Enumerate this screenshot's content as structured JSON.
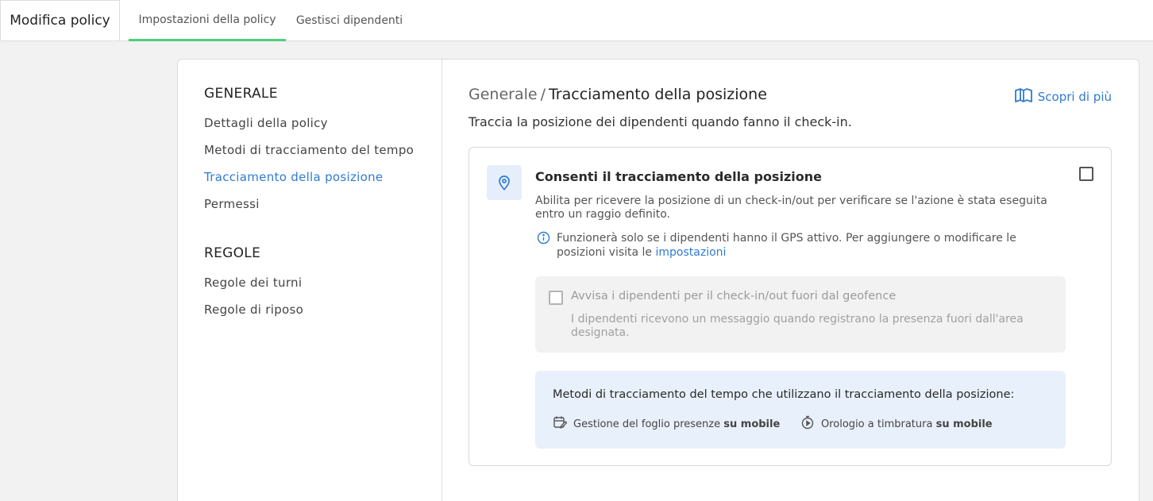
{
  "header": {
    "title": "Modifica policy",
    "tabs": [
      {
        "label": "Impostazioni della policy",
        "active": true
      },
      {
        "label": "Gestisci dipendenti",
        "active": false
      }
    ]
  },
  "sidebar": {
    "sections": [
      {
        "heading": "GENERALE",
        "items": [
          {
            "label": "Dettagli della policy"
          },
          {
            "label": "Metodi di tracciamento del tempo"
          },
          {
            "label": "Tracciamento della posizione",
            "active": true
          },
          {
            "label": "Permessi"
          }
        ]
      },
      {
        "heading": "REGOLE",
        "items": [
          {
            "label": "Regole dei turni"
          },
          {
            "label": "Regole di riposo"
          }
        ]
      }
    ]
  },
  "main": {
    "breadcrumb_parent": "Generale",
    "breadcrumb_sep": "/",
    "breadcrumb_current": "Tracciamento della posizione",
    "learn_more": "Scopri di più",
    "subtitle": "Traccia la posizione dei dipendenti quando fanno il check-in.",
    "option": {
      "icon": "location-pin-icon",
      "title": "Consenti il tracciamento della posizione",
      "checked": false,
      "description": "Abilita per ricevere la posizione di un check-in/out per verificare se l'azione è stata eseguita entro un raggio definito.",
      "info_text": "Funzionerà solo se i dipendenti hanno il GPS attivo. Per aggiungere o modificare le posizioni visita le",
      "info_link": "impostazioni"
    },
    "geofence": {
      "label": "Avvisa i dipendenti per il check-in/out fuori dal geofence",
      "description": "I dipendenti ricevono un messaggio quando registrano la presenza fuori dall'area designata.",
      "checked": false,
      "disabled": true
    },
    "methods": {
      "title": "Metodi di tracciamento del tempo che utilizzano il tracciamento della posizione:",
      "items": [
        {
          "icon": "calendar-edit-icon",
          "label": "Gestione del foglio presenze",
          "suffix": "su mobile"
        },
        {
          "icon": "stopwatch-icon",
          "label": "Orologio a timbratura",
          "suffix": "su mobile"
        }
      ]
    }
  },
  "colors": {
    "accent": "#2f7bd1",
    "tab_underline": "#4cd07a",
    "info_box": "#e8f0fb"
  }
}
